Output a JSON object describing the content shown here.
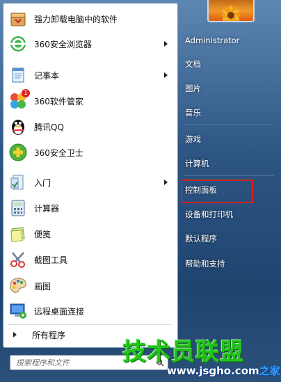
{
  "programs": [
    {
      "label": "强力卸载电脑中的软件",
      "icon": "uninstall-box-icon",
      "submenu": false
    },
    {
      "label": "360安全浏览器",
      "icon": "360-browser-icon",
      "submenu": true
    },
    {
      "label": "记事本",
      "icon": "notepad-icon",
      "submenu": true
    },
    {
      "label": "360软件管家",
      "icon": "360-software-manager-icon",
      "submenu": false,
      "badge": "1"
    },
    {
      "label": "腾讯QQ",
      "icon": "qq-penguin-icon",
      "submenu": false
    },
    {
      "label": "360安全卫士",
      "icon": "360-security-guard-icon",
      "submenu": false
    },
    {
      "label": "入门",
      "icon": "getting-started-icon",
      "submenu": true
    },
    {
      "label": "计算器",
      "icon": "calculator-icon",
      "submenu": false
    },
    {
      "label": "便笺",
      "icon": "sticky-notes-icon",
      "submenu": false
    },
    {
      "label": "截图工具",
      "icon": "snipping-tool-icon",
      "submenu": false
    },
    {
      "label": "画图",
      "icon": "paint-icon",
      "submenu": false
    },
    {
      "label": "远程桌面连接",
      "icon": "remote-desktop-icon",
      "submenu": false
    }
  ],
  "all_programs": "所有程序",
  "search": {
    "placeholder": "搜索程序和文件"
  },
  "right": [
    {
      "label": "Administrator"
    },
    {
      "label": "文档"
    },
    {
      "label": "图片"
    },
    {
      "label": "音乐"
    },
    {
      "label": "游戏"
    },
    {
      "label": "计算机"
    },
    {
      "label": "控制面板",
      "highlighted": true
    },
    {
      "label": "设备和打印机"
    },
    {
      "label": "默认程序"
    },
    {
      "label": "帮助和支持"
    }
  ],
  "watermark": {
    "title": "技术员联盟",
    "url": "www.jsgho.com",
    "suffix": "之家"
  },
  "colors": {
    "highlight_box": "#d0241c",
    "watermark_green": "#22c41c"
  }
}
